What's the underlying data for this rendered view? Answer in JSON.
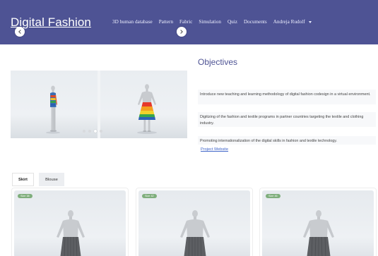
{
  "navbar": {
    "brand": "Digital Fashion",
    "items": [
      "3D human database",
      "Pattern",
      "Fabric",
      "Simulation",
      "Quiz",
      "Documents"
    ],
    "user": "Andreja Rudolf"
  },
  "carousel": {
    "slide_count": 4,
    "active_index": 2
  },
  "objectives": {
    "title": "Objectives",
    "items": [
      "Introduce new teaching and learning methodology of digital fashion codesign in a virtual environment.",
      "Digitizing of the fashion and textile programs in partner countries targeting the textile and clothing industry.",
      "Promoting internationalization of the digital skills in fashion and textile technology."
    ],
    "link": "Project Website"
  },
  "tabs": [
    "Skirt",
    "Blouse"
  ],
  "active_tab": "Skirt",
  "cards": [
    {
      "size": "Size 38"
    },
    {
      "size": "Size 42"
    },
    {
      "size": "Size 46"
    }
  ],
  "colors": {
    "navbar": "#4e5394",
    "accent": "#4e5394",
    "link": "#3d63c8",
    "badge": "#7fae7c"
  }
}
